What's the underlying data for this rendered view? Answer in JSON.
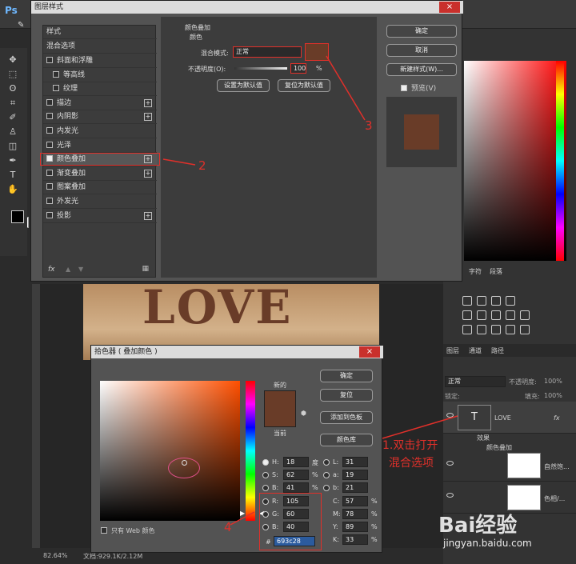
{
  "app": {
    "logo": "Ps"
  },
  "layer_style_dialog": {
    "title": "图层样式",
    "close": "×",
    "list_header": "样式",
    "blend_options": "混合选项",
    "items": [
      {
        "label": "斜面和浮雕",
        "checked": false,
        "plus": false
      },
      {
        "label": "等高线",
        "checked": false,
        "plus": false
      },
      {
        "label": "纹理",
        "checked": false,
        "plus": false
      },
      {
        "label": "描边",
        "checked": false,
        "plus": true
      },
      {
        "label": "内阴影",
        "checked": false,
        "plus": true
      },
      {
        "label": "内发光",
        "checked": false,
        "plus": false
      },
      {
        "label": "光泽",
        "checked": false,
        "plus": false
      },
      {
        "label": "颜色叠加",
        "checked": true,
        "plus": true
      },
      {
        "label": "渐变叠加",
        "checked": false,
        "plus": true
      },
      {
        "label": "图案叠加",
        "checked": false,
        "plus": false
      },
      {
        "label": "外发光",
        "checked": false,
        "plus": false
      },
      {
        "label": "投影",
        "checked": false,
        "plus": true
      }
    ],
    "fx": "fx",
    "section_title": "颜色叠加",
    "section_sub": "颜色",
    "blend_mode_label": "混合模式:",
    "blend_mode_value": "正常",
    "opacity_label": "不透明度(O):",
    "opacity_value": "100",
    "opacity_unit": "%",
    "set_default": "设置为默认值",
    "reset_default": "复位为默认值",
    "ok": "确定",
    "cancel": "取消",
    "new_style": "新建样式(W)...",
    "preview": "预览(V)",
    "overlay_color": "#693c28"
  },
  "color_picker": {
    "title": "拾色器 ( 叠加颜色 )",
    "close": "×",
    "new_label": "新的",
    "current_label": "当前",
    "ok": "确定",
    "reset": "复位",
    "add_swatch": "添加到色板",
    "color_lib": "颜色库",
    "web_only": "只有 Web 颜色",
    "H": "18",
    "H_unit": "度",
    "S": "62",
    "S_unit": "%",
    "B": "41",
    "B_unit": "%",
    "R": "105",
    "G": "60",
    "Bv": "40",
    "L": "31",
    "a": "19",
    "b": "21",
    "C": "57",
    "M": "78",
    "Y": "89",
    "K": "33",
    "pct": "%",
    "hex_label": "#",
    "hex": "693c28"
  },
  "canvas": {
    "text": "LOVE",
    "zoom": "82.64%",
    "doc": "文档:929.1K/2.12M"
  },
  "layers_panel": {
    "tabs": [
      "图层",
      "通道",
      "路径"
    ],
    "mode": "正常",
    "opacity_label": "不透明度:",
    "opacity": "100%",
    "lock_label": "锁定:",
    "fill_label": "填充:",
    "fill": "100%",
    "layers": [
      {
        "name": "LOVE",
        "type": "T",
        "fx": "fx"
      },
      {
        "name": "自然饱...",
        "type": "adj"
      },
      {
        "name": "色相/...",
        "type": "adj"
      }
    ],
    "effects_label": "效果",
    "effect_item": "颜色叠加",
    "panel_tab1": "字符",
    "panel_tab2": "段落"
  },
  "annotations": {
    "a1": "1.双击打开",
    "a1b": "混合选项",
    "a2": "2",
    "a3": "3",
    "a4": "4"
  },
  "watermark": {
    "brand": "Bai经验",
    "site": "jingyan.baidu.com"
  }
}
